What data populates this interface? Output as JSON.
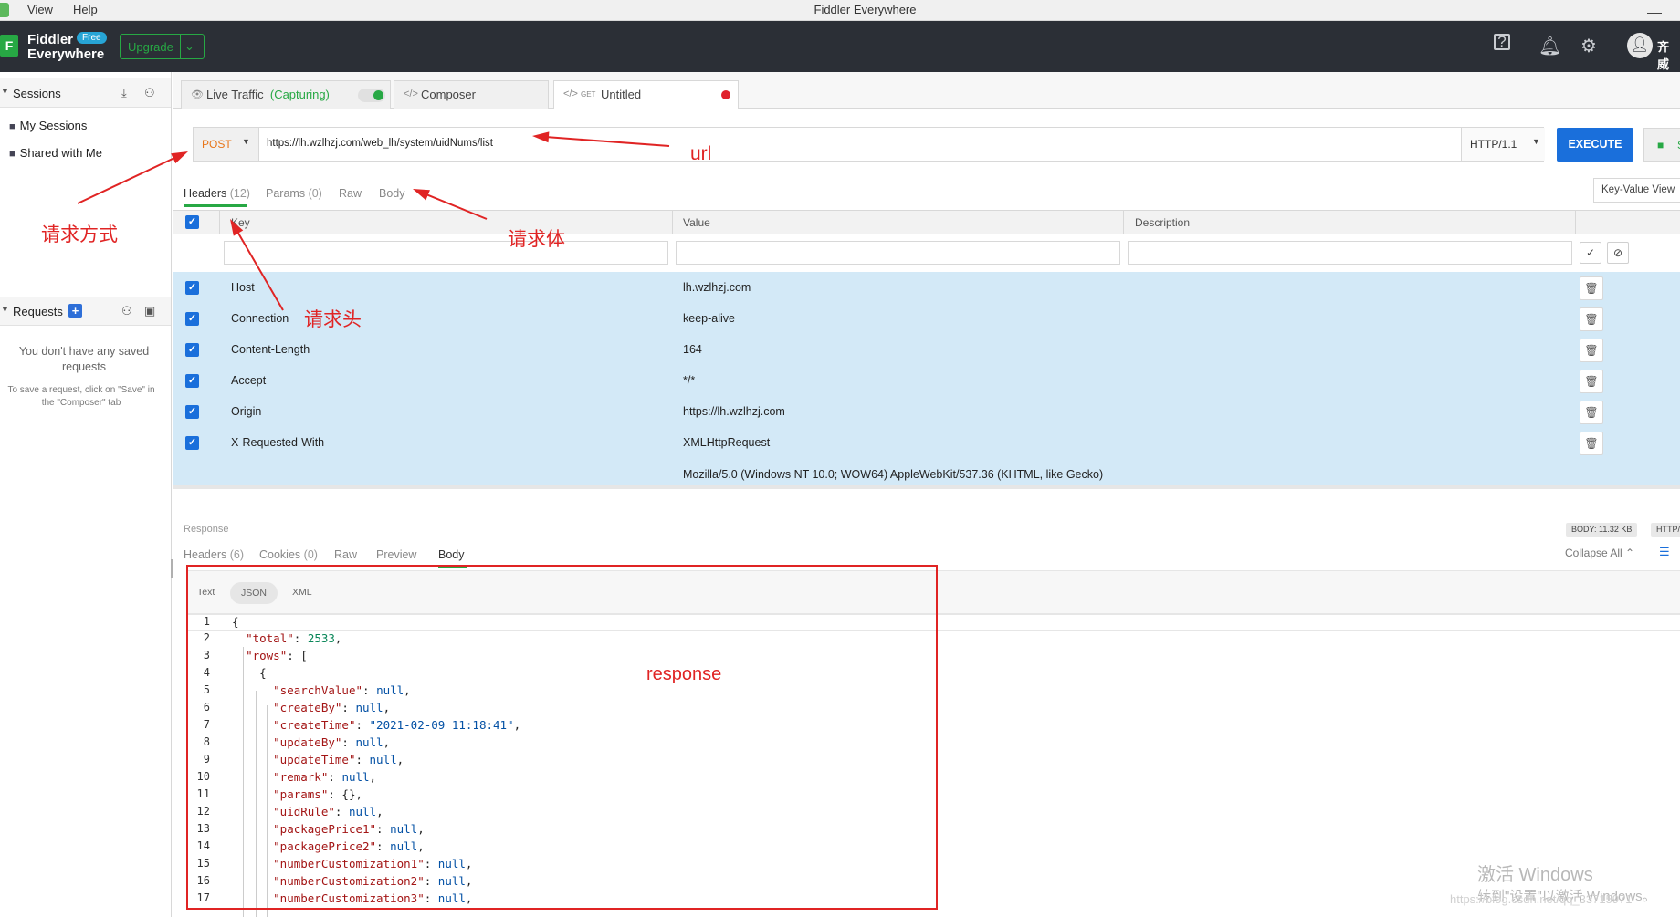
{
  "menu": {
    "view": "View",
    "help": "Help",
    "window_title": "Fiddler Everywhere"
  },
  "header": {
    "logo_letter": "F",
    "brand_line1": "Fiddler",
    "brand_line2": "Everywhere",
    "free_badge": "Free",
    "upgrade_label": "Upgrade",
    "user_name": "齐威"
  },
  "sidebar": {
    "sessions_title": "Sessions",
    "session_items": [
      {
        "label": "My Sessions",
        "icon": "folder-icon"
      },
      {
        "label": "Shared with Me",
        "icon": "shared-folder-icon"
      }
    ],
    "requests_title": "Requests",
    "empty_title": "You don't have any saved requests",
    "empty_hint": "To save a request, click on \"Save\" in the \"Composer\" tab"
  },
  "tabs": [
    {
      "label": "Live Traffic",
      "extra": "(Capturing)"
    },
    {
      "label": "Composer"
    },
    {
      "label": "Untitled",
      "method": "GET"
    }
  ],
  "request": {
    "method": "POST",
    "url": "https://lh.wzlhzj.com/web_lh/system/uidNums/list",
    "protocol": "HTTP/1.1",
    "execute_label": "EXECUTE",
    "save_label": "S"
  },
  "request_tabs": [
    {
      "label": "Headers",
      "count": "(12)"
    },
    {
      "label": "Params",
      "count": "(0)"
    },
    {
      "label": "Raw",
      "count": ""
    },
    {
      "label": "Body",
      "count": ""
    }
  ],
  "key_value_view": "Key-Value View",
  "grid": {
    "col_key": "Key",
    "col_value": "Value",
    "col_description": "Description",
    "rows": [
      {
        "key": "Host",
        "value": "lh.wzlhzj.com"
      },
      {
        "key": "Connection",
        "value": "keep-alive"
      },
      {
        "key": "Content-Length",
        "value": "164"
      },
      {
        "key": "Accept",
        "value": "*/*"
      },
      {
        "key": "Origin",
        "value": "https://lh.wzlhzj.com"
      },
      {
        "key": "X-Requested-With",
        "value": "XMLHttpRequest"
      }
    ],
    "partial_value": "Mozilla/5.0 (Windows NT 10.0; WOW64) AppleWebKit/537.36 (KHTML, like Gecko)"
  },
  "response": {
    "label": "Response",
    "body_size": "BODY: 11.32 KB",
    "http_badge": "HTTP/",
    "tabs": [
      {
        "label": "Headers",
        "count": "(6)"
      },
      {
        "label": "Cookies",
        "count": "(0)"
      },
      {
        "label": "Raw",
        "count": ""
      },
      {
        "label": "Preview",
        "count": ""
      },
      {
        "label": "Body",
        "count": ""
      }
    ],
    "collapse_all": "Collapse All",
    "formats": [
      "Text",
      "JSON",
      "XML"
    ]
  },
  "code_lines": [
    {
      "n": "1",
      "text": "{"
    },
    {
      "n": "2",
      "text": "  \"total\": 2533,"
    },
    {
      "n": "3",
      "text": "  \"rows\": ["
    },
    {
      "n": "4",
      "text": "    {"
    },
    {
      "n": "5",
      "text": "      \"searchValue\": null,"
    },
    {
      "n": "6",
      "text": "      \"createBy\": null,"
    },
    {
      "n": "7",
      "text": "      \"createTime\": \"2021-02-09 11:18:41\","
    },
    {
      "n": "8",
      "text": "      \"updateBy\": null,"
    },
    {
      "n": "9",
      "text": "      \"updateTime\": null,"
    },
    {
      "n": "10",
      "text": "      \"remark\": null,"
    },
    {
      "n": "11",
      "text": "      \"params\": {},"
    },
    {
      "n": "12",
      "text": "      \"uidRule\": null,"
    },
    {
      "n": "13",
      "text": "      \"packagePrice1\": null,"
    },
    {
      "n": "14",
      "text": "      \"packagePrice2\": null,"
    },
    {
      "n": "15",
      "text": "      \"numberCustomization1\": null,"
    },
    {
      "n": "16",
      "text": "      \"numberCustomization2\": null,"
    },
    {
      "n": "17",
      "text": "      \"numberCustomization3\": null,"
    }
  ],
  "annotations": {
    "method": "请求方式",
    "url": "url",
    "body": "请求体",
    "headers": "请求头",
    "response": "response"
  },
  "watermark": {
    "line1": "激活 Windows",
    "line2": "转到\"设置\"以激活 Windows。",
    "line3": "https://blog.csdn.net/qq_33715971"
  },
  "colors": {
    "accent_green": "#27a844",
    "execute_blue": "#1a6fdb",
    "method_orange": "#e8761a",
    "header_dark": "#2b2f36",
    "row_highlight": "#d3e9f7",
    "annotation_red": "#e02424"
  }
}
